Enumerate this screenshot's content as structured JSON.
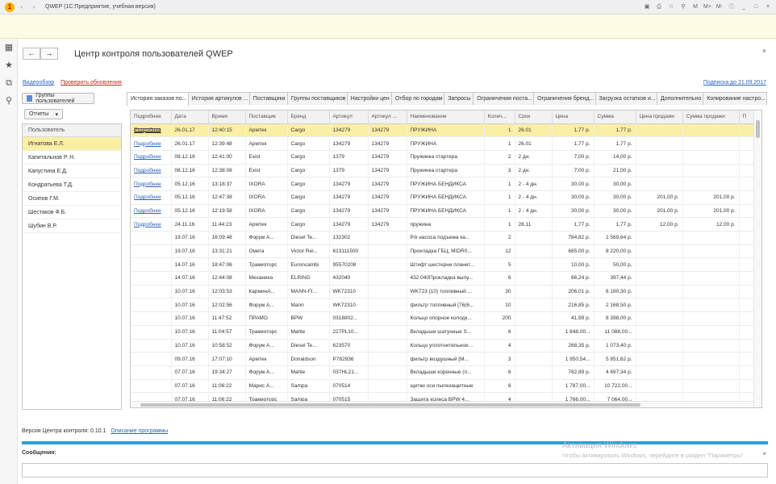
{
  "window": {
    "title": "QWEP  (1С:Предприятие, учебная версия)",
    "toolbar_right": [
      "M",
      "M+",
      "M-",
      "_",
      "□",
      "×"
    ]
  },
  "nav": {
    "back": "←",
    "forward": "→"
  },
  "page": {
    "title": "Центр контроля пользователей QWEP",
    "close": "×"
  },
  "links": {
    "video": "Видеообзор",
    "check_updates": "Проверить обновления",
    "subscription": "Подписка до 21.09.2017"
  },
  "left": {
    "groups_button": "Группы пользователей",
    "reports_button": "Отчеты",
    "users_header": "Пользователь",
    "users": [
      "Игнатова Е.Л.",
      "Капитальнов Р. Н.",
      "Капустина Е.Д.",
      "Кондратьева Т.Д.",
      "Осипов Г.М.",
      "Шестаков Ф.Б.",
      "Шубин В.Р."
    ]
  },
  "tabs": [
    "История заказов по...",
    "История артикулов ...",
    "Поставщики",
    "Группы поставщиков",
    "Настройки цен",
    "Отбор по городам",
    "Запросы",
    "Ограничения поста...",
    "Ограничения бренд...",
    "Загрузка остатков и...",
    "Дополнительно",
    "Копирование настро..."
  ],
  "grid": {
    "columns": [
      "Подробнее",
      "Дата",
      "Время",
      "Поставщик",
      "Бренд",
      "Артикул",
      "Артикул ...",
      "Наименование",
      "Колич...",
      "Срок",
      "Цена",
      "Сумма",
      "Цена продажи",
      "Сумма продажи",
      "П"
    ],
    "rows": [
      [
        "Подробнее",
        "26.01.17",
        "12:40:15",
        "Армтек",
        "Cargo",
        "134279",
        "134279",
        "ПРУЖИНА",
        "1",
        "26.01",
        "1,77 р.",
        "1,77 р.",
        "",
        "",
        ""
      ],
      [
        "Подробнее",
        "26.01.17",
        "12:39:48",
        "Армтек",
        "Cargo",
        "134279",
        "134279",
        "ПРУЖИНА",
        "1",
        "26.01",
        "1,77 р.",
        "1,77 р.",
        "",
        "",
        ""
      ],
      [
        "Подробнее",
        "08.12.16",
        "12:41:00",
        "Exist",
        "Cargo",
        "1379",
        "134279",
        "Пружинка стартера",
        "2",
        "2 дн.",
        "7,00 р.",
        "14,00 р.",
        "",
        "",
        ""
      ],
      [
        "Подробнее",
        "08.12.16",
        "12:38:08",
        "Exist",
        "Cargo",
        "1379",
        "134279",
        "Пружинка стартера",
        "3",
        "2 дн.",
        "7,00 р.",
        "21,00 р.",
        "",
        "",
        ""
      ],
      [
        "Подробнее",
        "05.12.16",
        "13:18:37",
        "IXORA",
        "Cargo",
        "134279",
        "134279",
        "ПРУЖИНА БЕНДИКСА",
        "1",
        "2 - 4 дн.",
        "30,00 р.",
        "30,00 р.",
        "",
        "",
        ""
      ],
      [
        "Подробнее",
        "05.12.16",
        "12:47:38",
        "IXORA",
        "Cargo",
        "134279",
        "134279",
        "ПРУЖИНА БЕНДИКСА",
        "1",
        "2 - 4 дн.",
        "30,00 р.",
        "30,00 р.",
        "201,00 р.",
        "201,00 р.",
        ""
      ],
      [
        "Подробнее",
        "05.12.16",
        "12:19:58",
        "IXORA",
        "Cargo",
        "134279",
        "134279",
        "ПРУЖИНА БЕНДИКСА",
        "1",
        "2 - 4 дн.",
        "30,00 р.",
        "30,00 р.",
        "201,00 р.",
        "201,00 р.",
        ""
      ],
      [
        "Подробнее",
        "24.11.16",
        "11:44:23",
        "Армтек",
        "Cargo",
        "134279",
        "134279",
        "пружина",
        "1",
        "28.11",
        "1,77 р.",
        "1,77 р.",
        "12,00 р.",
        "12,00 р.",
        ""
      ],
      [
        "",
        "19.07.16",
        "16:09:48",
        "Форум А...",
        "Diesel Te...",
        "132302",
        "",
        "Р/к насоса подъема ка...",
        "2",
        "",
        "784,82 р.",
        "1 569,64 р.",
        "",
        "",
        ""
      ],
      [
        "",
        "19.07.16",
        "13:31:21",
        "Омега",
        "Victor Rei...",
        "613111500",
        "",
        "Прокладка ГБЦ, MIDR0...",
        "12",
        "",
        "685,00 р.",
        "8 220,00 р.",
        "",
        "",
        ""
      ],
      [
        "",
        "14.07.16",
        "18:47:06",
        "Тракмоторс",
        "Euroncambi",
        "95570208",
        "",
        "Штифт шестерни планет...",
        "5",
        "",
        "10,00 р.",
        "50,00 р.",
        "",
        "",
        ""
      ],
      [
        "",
        "14.07.16",
        "12:44:08",
        "Механика",
        "ELRING",
        "432040",
        "",
        "432.040Прокладка выпу...",
        "6",
        "",
        "66,24 р.",
        "397,44 р.",
        "",
        "",
        ""
      ],
      [
        "",
        "10.07.16",
        "12:03:53",
        "КарминА...",
        "MANN-FI...",
        "WK72310",
        "",
        "WK723 (10) топливный ...",
        "30",
        "",
        "206,01 р.",
        "6 180,30 р.",
        "",
        "",
        ""
      ],
      [
        "",
        "10.07.16",
        "12:02:56",
        "Форум А...",
        "Mann",
        "WK72310",
        "",
        "фильтр топливный [76(6...",
        "10",
        "",
        "216,85 р.",
        "2 168,50 р.",
        "",
        "",
        ""
      ],
      [
        "",
        "10.07.16",
        "11:47:52",
        "ПРАМО",
        "BPW",
        "0318802...",
        "",
        "Кольцо опорное колодк...",
        "200",
        "",
        "41,99 р.",
        "8 398,00 р.",
        "",
        "",
        ""
      ],
      [
        "",
        "10.07.16",
        "11:04:57",
        "Тракмоторс",
        "Mahle",
        "227PL10...",
        "",
        "Вкладыши шатунные S...",
        "6",
        "",
        "1 848,00...",
        "11 088,00...",
        "",
        "",
        ""
      ],
      [
        "",
        "10.07.16",
        "10:58:52",
        "Форум А...",
        "Diesel Te...",
        "623570",
        "",
        "Кольцо уплотнительное...",
        "4",
        "",
        "268,35 р.",
        "1 073,40 р.",
        "",
        "",
        ""
      ],
      [
        "",
        "09.07.16",
        "17:07:10",
        "Армтек",
        "Donaldson",
        "P782936",
        "",
        "фильтр воздушный [M...",
        "3",
        "",
        "1 950,54...",
        "5 851,62 р.",
        "",
        "",
        ""
      ],
      [
        "",
        "07.07.16",
        "19:34:27",
        "Форум А...",
        "Mahle",
        "037HL21...",
        "",
        "Вкладыши коренные (п...",
        "6",
        "",
        "782,89 р.",
        "4 697,34 р.",
        "",
        "",
        ""
      ],
      [
        "",
        "07.07.16",
        "11:06:22",
        "Марис А...",
        "Sampa",
        "070514",
        "",
        "щитки оси пыпезащитные",
        "6",
        "",
        "1 787,00...",
        "10 722,00...",
        "",
        "",
        ""
      ],
      [
        "",
        "07.07.16",
        "11:06:22",
        "Тракмоторс",
        "Sampa",
        "070515",
        "",
        "Защита колеса BPW 4...",
        "4",
        "",
        "1 766,00...",
        "7 064,00...",
        "",
        "",
        ""
      ]
    ]
  },
  "footer": {
    "version": "Версия Центра контроля: 0.10.1",
    "description_link": "Описание программы",
    "messages_label": "Сообщения:",
    "messages_close": "×"
  },
  "watermark": {
    "line1": "Активация Windows",
    "line2": "Чтобы активировать Windows, перейдите в раздел \"Параметры\""
  },
  "colors": {
    "selection": "#fbeea5",
    "accent_line": "#2e9fd8",
    "link": "#2a63b8",
    "update_link": "#d62020"
  }
}
